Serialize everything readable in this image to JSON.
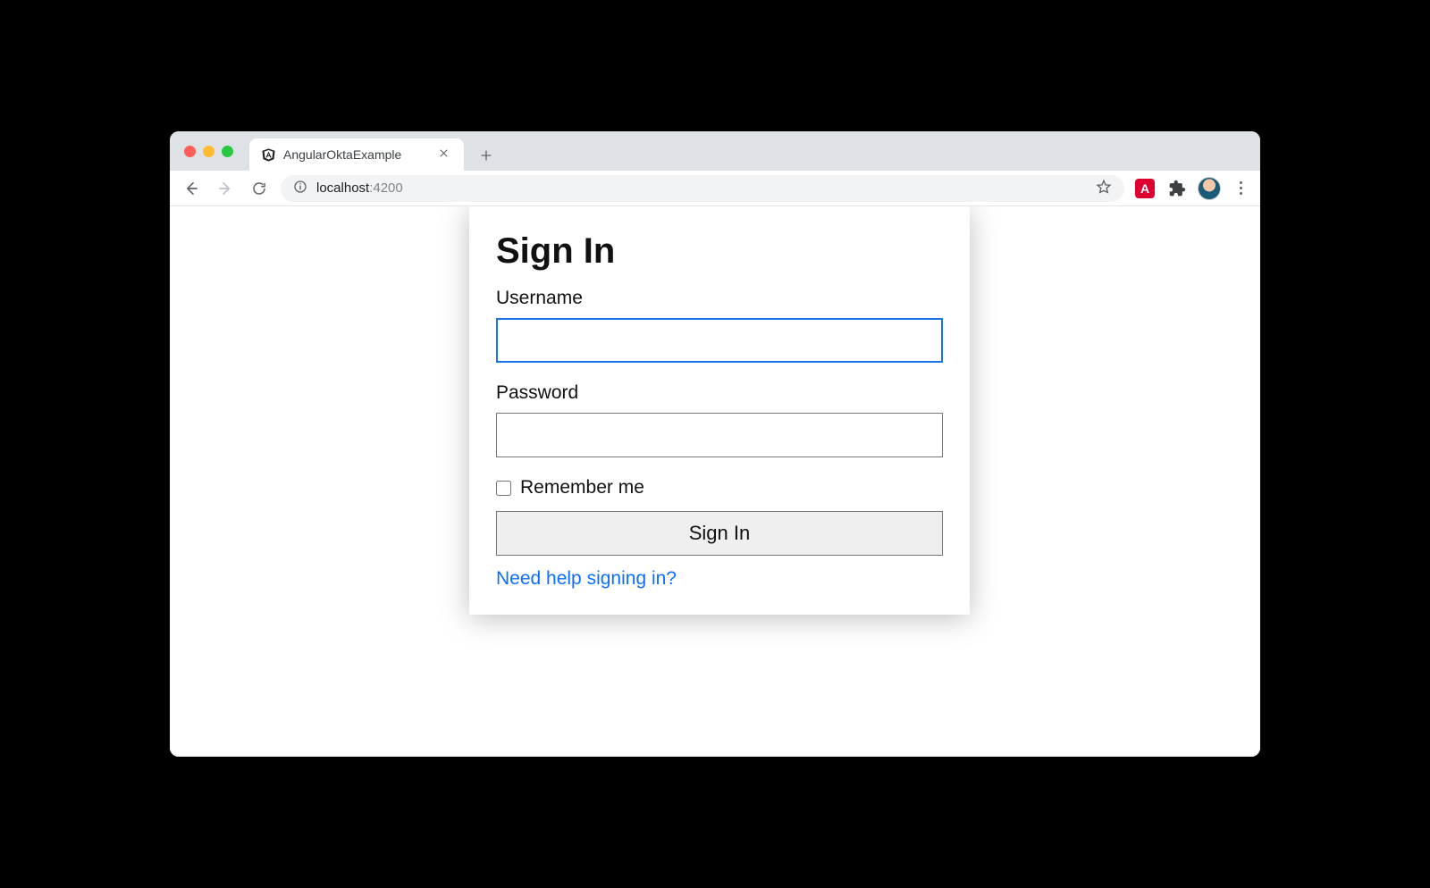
{
  "browser": {
    "tab_title": "AngularOktaExample",
    "url_host": "localhost",
    "url_port": ":4200"
  },
  "signin": {
    "title": "Sign In",
    "username_label": "Username",
    "username_value": "",
    "password_label": "Password",
    "password_value": "",
    "remember_label": "Remember me",
    "submit_label": "Sign In",
    "help_label": "Need help signing in?"
  }
}
